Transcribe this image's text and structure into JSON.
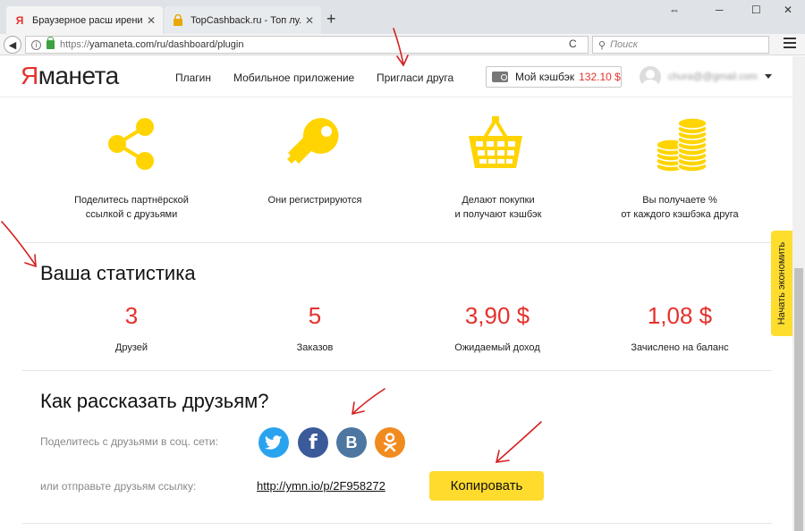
{
  "browser": {
    "tabs": [
      {
        "title": "Браузерное расш ирение...",
        "favicon": "Я",
        "favicon_color": "#e5312c",
        "active": true
      },
      {
        "title": "TopCashback.ru - Топ лу...",
        "favicon": "lock-favicon",
        "active": false
      }
    ],
    "url_protocol": "https://",
    "url_rest": "yamaneta.com/ru/dashboard/plugin",
    "search_placeholder": "Поиск"
  },
  "header": {
    "logo_first": "Я",
    "logo_rest": "манета",
    "nav": [
      "Плагин",
      "Мобильное приложение",
      "Пригласи друга"
    ],
    "cashback_label": "Мой кэшбэк",
    "cashback_amount": "132.10 $",
    "email": "chura@@gmail.com"
  },
  "steps": [
    {
      "icon": "share-icon",
      "line1": "Поделитесь партнёрской",
      "line2": "ссылкой с друзьями"
    },
    {
      "icon": "key-icon",
      "line1": "Они регистрируются",
      "line2": ""
    },
    {
      "icon": "basket-icon",
      "line1": "Делают покупки",
      "line2": "и получают кэшбэк"
    },
    {
      "icon": "coins-icon",
      "line1": "Вы получаете %",
      "line2": "от каждого кэшбэка друга"
    }
  ],
  "stats": {
    "title": "Ваша статистика",
    "items": [
      {
        "value": "3",
        "label": "Друзей"
      },
      {
        "value": "5",
        "label": "Заказов"
      },
      {
        "value": "3,90 $",
        "label": "Ожидаемый доход"
      },
      {
        "value": "1,08 $",
        "label": "Зачислено на баланс"
      }
    ]
  },
  "side_tab": "Начать экономить",
  "share": {
    "title": "Как рассказать друзьям?",
    "social_text": "Поделитесь с друзьями в соц. сети:",
    "social": [
      {
        "name": "twitter",
        "color": "#2aa3ef"
      },
      {
        "name": "facebook",
        "color": "#3b5a9a"
      },
      {
        "name": "vkontakte",
        "glyph": "B",
        "color": "#4d76a1"
      },
      {
        "name": "odnoklassniki",
        "color": "#f18b1f"
      }
    ],
    "link_text": "или отправьте друзьям ссылку:",
    "link": "http://ymn.io/p/2F958272",
    "copy_label": "Копировать"
  },
  "colors": {
    "accent": "#e5312c",
    "yellow": "#ffdb2d",
    "icon_yellow": "#ffd400"
  }
}
